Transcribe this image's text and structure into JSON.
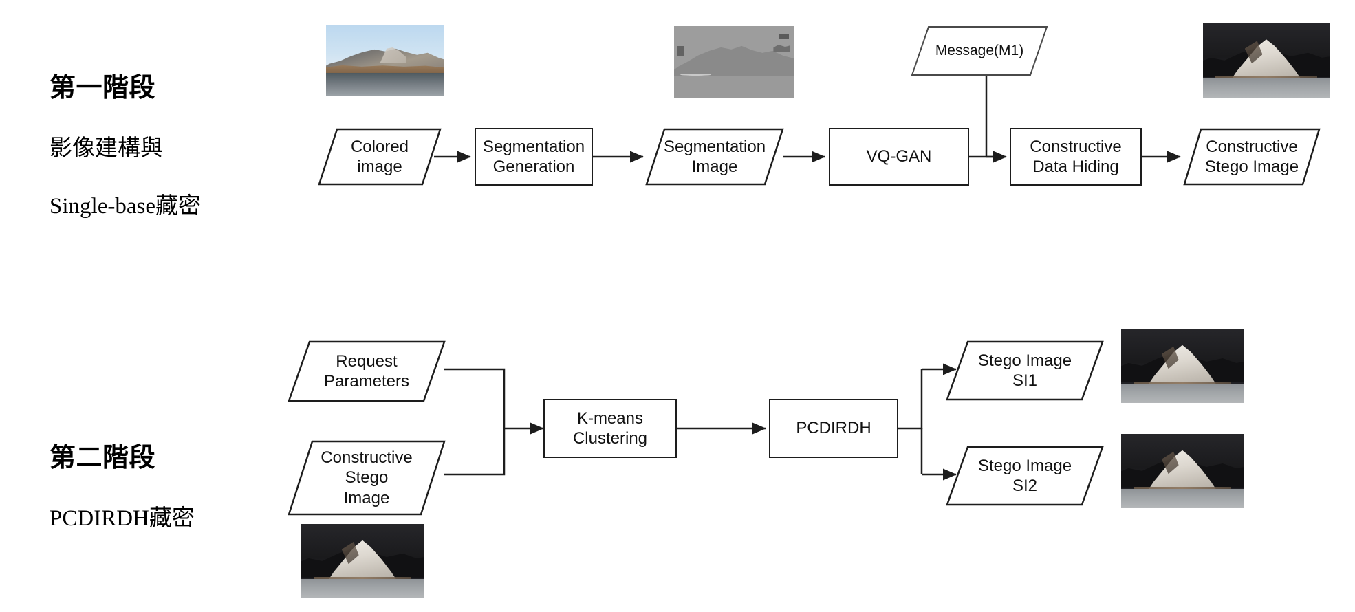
{
  "figure": {
    "title": "Two-stage constructive image steganography framework",
    "stroke_color": "#1d1d1d",
    "background": "#ffffff"
  },
  "stages": [
    {
      "id": "stage-1",
      "label_line1": "第一階段",
      "label_line2": "影像建構與",
      "label_line3": "Single-base藏密"
    },
    {
      "id": "stage-2",
      "label_line1": "第二階段",
      "label_line2": "PCDIRDH藏密",
      "label_line3": ""
    }
  ],
  "stage1": {
    "nodes": {
      "colored_image": "Colored\nimage",
      "segmentation_generation": "Segmentation\nGeneration",
      "segmentation_image": "Segmentation\nImage",
      "vq_gan": "VQ-GAN",
      "message": "Message(M1)",
      "constructive_data_hiding": "Constructive\nData Hiding",
      "constructive_stego_image": "Constructive\nStego Image"
    },
    "thumbnails": {
      "colored_photo": "colored-mountain-lake-photo",
      "segmentation_map": "grayscale-segmentation-map",
      "stego_photo": "dark-snow-mountain-stego-photo"
    }
  },
  "stage2": {
    "nodes": {
      "request_parameters": "Request\nParameters",
      "constructive_stego_image": "Constructive\nStego\nImage",
      "kmeans_clustering": "K-means\nClustering",
      "pcdirdh": "PCDIRDH",
      "stego_image_si1": "Stego Image\nSI1",
      "stego_image_si2": "Stego Image\nSI2"
    },
    "thumbnails": {
      "input_stego_photo": "dark-snow-mountain-stego-photo",
      "output_stego_photo_si1": "dark-snow-mountain-stego-photo-si1",
      "output_stego_photo_si2": "dark-snow-mountain-stego-photo-si2"
    }
  }
}
